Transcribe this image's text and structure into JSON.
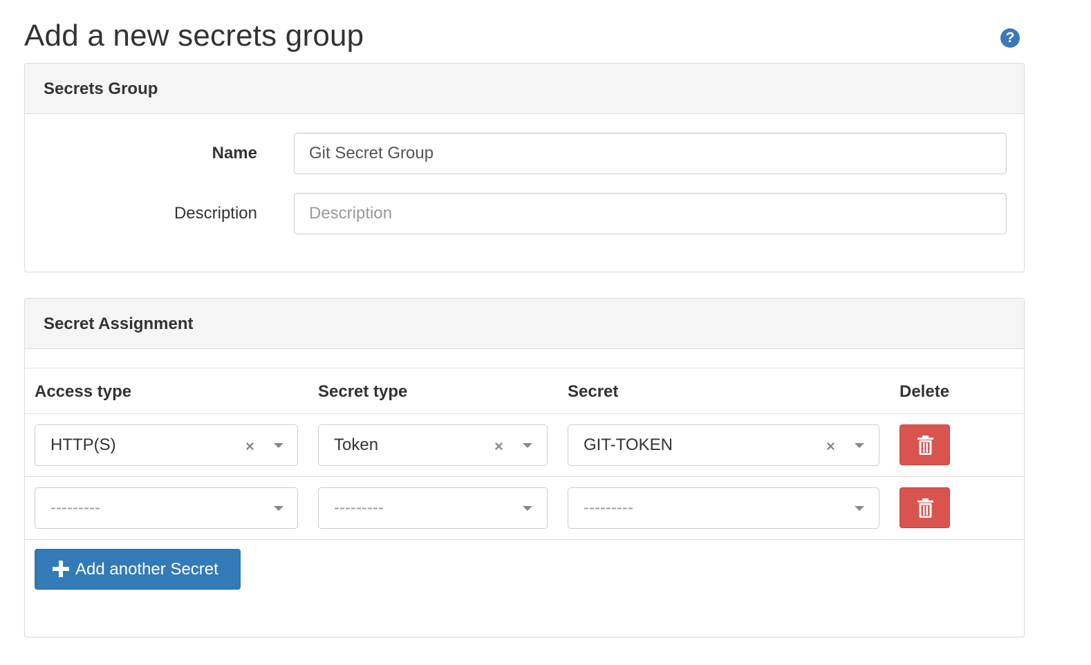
{
  "page": {
    "title": "Add a new secrets group",
    "help_icon": "question-circle-icon",
    "help_glyph": "?"
  },
  "secrets_group": {
    "heading": "Secrets Group",
    "name_label": "Name",
    "name_value": "Git Secret Group",
    "description_label": "Description",
    "description_placeholder": "Description"
  },
  "secret_assignment": {
    "heading": "Secret Assignment",
    "columns": [
      "Access type",
      "Secret type",
      "Secret",
      "Delete"
    ],
    "rows": [
      {
        "access_type": "HTTP(S)",
        "secret_type": "Token",
        "secret": "GIT-TOKEN",
        "clearable": true
      },
      {
        "access_type": "---------",
        "secret_type": "---------",
        "secret": "---------",
        "clearable": false
      }
    ],
    "clear_glyph": "×",
    "add_button_label": "Add another Secret"
  },
  "colors": {
    "primary": "#337ab7",
    "danger": "#d9534f",
    "help": "#3a78bd",
    "panel_heading_bg": "#f5f5f5",
    "border": "#dddddd"
  }
}
